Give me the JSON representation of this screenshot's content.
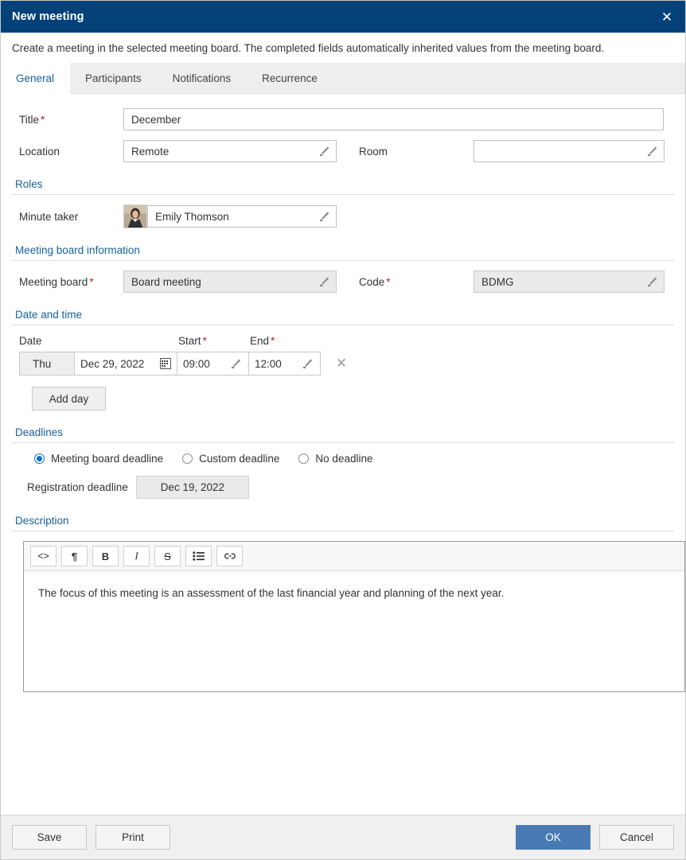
{
  "window": {
    "title": "New meeting",
    "close_icon": "close-icon",
    "subtitle": "Create a meeting in the selected meeting board. The completed fields automatically inherited values from the meeting board."
  },
  "tabs": [
    {
      "label": "General",
      "active": true
    },
    {
      "label": "Participants",
      "active": false
    },
    {
      "label": "Notifications",
      "active": false
    },
    {
      "label": "Recurrence",
      "active": false
    }
  ],
  "general": {
    "title_field": {
      "label": "Title",
      "required": true,
      "value": "December"
    },
    "location_field": {
      "label": "Location",
      "required": false,
      "value": "Remote",
      "icon": "pencil-icon"
    },
    "room_field": {
      "label": "Room",
      "required": false,
      "value": "",
      "icon": "pencil-icon"
    }
  },
  "roles": {
    "heading": "Roles",
    "minute_taker": {
      "label": "Minute taker",
      "value": "Emily Thomson",
      "avatar": "person-photo",
      "icon": "pencil-icon"
    }
  },
  "board_info": {
    "heading": "Meeting board information",
    "meeting_board": {
      "label": "Meeting board",
      "required": true,
      "value": "Board meeting",
      "icon": "pencil-icon",
      "disabled": true
    },
    "code": {
      "label": "Code",
      "required": true,
      "value": "BDMG",
      "icon": "pencil-icon",
      "disabled": true
    }
  },
  "datetime": {
    "heading": "Date and time",
    "columns": {
      "date": "Date",
      "start": "Start",
      "end": "End"
    },
    "start_required": true,
    "end_required": true,
    "rows": [
      {
        "weekday": "Thu",
        "date": "Dec 29, 2022",
        "date_icon": "calendar-icon",
        "start": "09:00",
        "start_icon": "pencil-icon",
        "end": "12:00",
        "end_icon": "pencil-icon",
        "remove_icon": "close-icon"
      }
    ],
    "add_day_label": "Add day"
  },
  "deadlines": {
    "heading": "Deadlines",
    "options": [
      {
        "label": "Meeting board deadline",
        "selected": true
      },
      {
        "label": "Custom deadline",
        "selected": false
      },
      {
        "label": "No deadline",
        "selected": false
      }
    ],
    "registration_deadline": {
      "label": "Registration deadline",
      "value": "Dec 19, 2022"
    }
  },
  "description": {
    "heading": "Description",
    "toolbar": [
      {
        "name": "code-icon",
        "glyph": "<>"
      },
      {
        "name": "paragraph-icon",
        "glyph": "¶"
      },
      {
        "name": "bold-icon",
        "glyph": "B"
      },
      {
        "name": "italic-icon",
        "glyph": "I"
      },
      {
        "name": "strikethrough-icon",
        "glyph": "S"
      },
      {
        "name": "bullet-list-icon",
        "glyph": "☰"
      },
      {
        "name": "link-icon",
        "glyph": "∞"
      }
    ],
    "text": "The focus of this meeting is an assessment of the last financial year and planning of the next year."
  },
  "footer": {
    "save_label": "Save",
    "print_label": "Print",
    "ok_label": "OK",
    "cancel_label": "Cancel"
  },
  "colors": {
    "titlebar": "#044178",
    "section_heading": "#17619c",
    "primary_button": "#4a7ab5",
    "required_star": "#b32121",
    "radio_selected": "#0b6fd4"
  }
}
